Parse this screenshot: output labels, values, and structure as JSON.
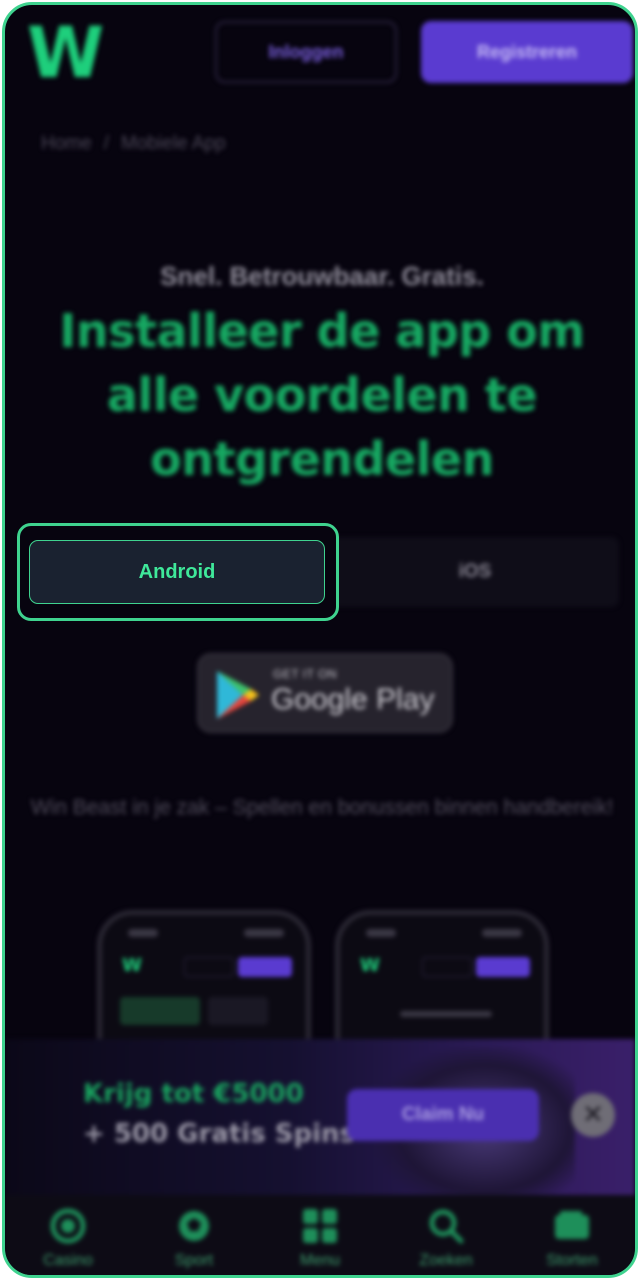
{
  "header": {
    "logo": "W",
    "login_label": "Inloggen",
    "register_label": "Registreren"
  },
  "breadcrumb": {
    "home": "Home",
    "separator": "/",
    "current": "Mobiele App"
  },
  "hero": {
    "tagline": "Snel. Betrouwbaar. Gratis.",
    "headline": "Installeer de app om alle voordelen te ontgrendelen"
  },
  "platform_tabs": {
    "items": [
      {
        "label": "Android",
        "active": true
      },
      {
        "label": "iOS",
        "active": false
      }
    ]
  },
  "store_badge": {
    "small_text": "GET IT ON",
    "big_text": "Google Play"
  },
  "subtext": "Win Beast in je zak – Spellen en bonussen binnen handbereik!",
  "phone_previews": {
    "logo": "W"
  },
  "promo": {
    "line1": "Krijg tot €5000",
    "line2": "+ 500 Gratis Spins",
    "claim_label": "Claim Nu",
    "close_icon": "close-icon"
  },
  "bottom_nav": {
    "items": [
      {
        "label": "Casino",
        "icon": "casino-chip-icon"
      },
      {
        "label": "Sport",
        "icon": "soccer-ball-icon"
      },
      {
        "label": "Menu",
        "icon": "grid-icon"
      },
      {
        "label": "Zoeken",
        "icon": "search-icon"
      },
      {
        "label": "Storten",
        "icon": "wallet-icon"
      }
    ]
  },
  "colors": {
    "accent_green": "#3fd38f",
    "brand_purple": "#5a3bd0",
    "background": "#07040f"
  }
}
